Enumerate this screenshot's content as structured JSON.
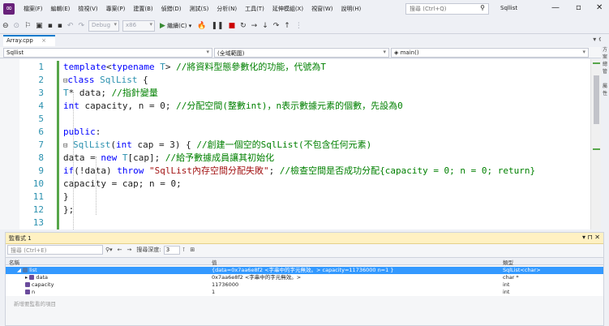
{
  "menu": [
    "檔案(F)",
    "編輯(E)",
    "檢視(V)",
    "專案(P)",
    "建置(B)",
    "偵錯(D)",
    "測試(S)",
    "分析(N)",
    "工具(T)",
    "延伸模組(X)",
    "視窗(W)",
    "說明(H)"
  ],
  "search": {
    "placeholder": "搜尋 (Ctrl+Q)",
    "icon": "search-icon"
  },
  "project_name": "Sqllist",
  "toolbar": {
    "config": "Debug",
    "platform": "x86",
    "continue": "繼續(C)"
  },
  "tab": {
    "label": "Array.cpp",
    "close": "×"
  },
  "navbar": {
    "project": "Sqllist",
    "scope": "(全域範圍)",
    "member": "main()"
  },
  "code_lines": [
    {
      "num": "1",
      "html": "<span class=\"kw\">template</span>&lt;<span class=\"kw\">typename</span> <span class=\"tp\">T</span>&gt; <span class=\"cm\">//將資料型態參數化的功能，代號為T</span>"
    },
    {
      "num": "2",
      "html": "<span class=\"fold\">⊟</span><span class=\"kw\">class</span> <span class=\"tp\">SqlList</span> {"
    },
    {
      "num": "3",
      "html": "    <span class=\"tp\">T</span>* data; <span class=\"cm\">//指針變量</span>"
    },
    {
      "num": "4",
      "html": "    <span class=\"kw\">int</span> capacity, n = 0; <span class=\"cm\">//分配空間(整數int)，n表示數據元素的個數，先設為0</span>"
    },
    {
      "num": "5",
      "html": ""
    },
    {
      "num": "6",
      "html": "<span class=\"kw\">public</span>:"
    },
    {
      "num": "7",
      "html": "<span class=\"fold\">⊟</span>   <span class=\"tp\">SqlList</span>(<span class=\"kw\">int</span> cap = 3) { <span class=\"cm\">//創建一個空的SqlList(不包含任何元素)</span>"
    },
    {
      "num": "8",
      "html": "        data = <span class=\"kw\">new</span> <span class=\"tp\">T</span>[cap]; <span class=\"cm\">//給予數據成員讓其初始化</span>"
    },
    {
      "num": "9",
      "html": "        <span class=\"kw\">if</span>(!data) <span class=\"kw\">throw</span> <span class=\"st\">\"SqlList內存空間分配失敗\"</span>; <span class=\"cm\">//檢查空間是否成功分配{capacity = 0; n = 0; return}</span>"
    },
    {
      "num": "10",
      "html": "        capacity = cap; n = 0;"
    },
    {
      "num": "11",
      "html": "    }"
    },
    {
      "num": "12",
      "html": "};"
    },
    {
      "num": "13",
      "html": ""
    }
  ],
  "watch": {
    "title": "監看式 1",
    "search_placeholder": "搜尋 (Ctrl+E)",
    "depth_label": "搜尋深度:",
    "depth_value": "3",
    "col_name": "名稱",
    "col_value": "值",
    "col_type": "類型",
    "rows": [
      {
        "name": "list",
        "value": "{data=0x7aa6e8f2 <字串中的字元無效。> capacity=11736000 n=1 }",
        "type": "SqlList<char>"
      },
      {
        "name": "data",
        "value": "0x7aa6e8f2 <字串中的字元無效。>",
        "type": "char *"
      },
      {
        "name": "capacity",
        "value": "11736000",
        "type": "int"
      },
      {
        "name": "n",
        "value": "1",
        "type": "int"
      }
    ],
    "add_placeholder": "新增要監看的項目"
  },
  "colors": {
    "accent": "#007acc",
    "selection": "#3399ff",
    "change_bar": "#57a64a"
  }
}
